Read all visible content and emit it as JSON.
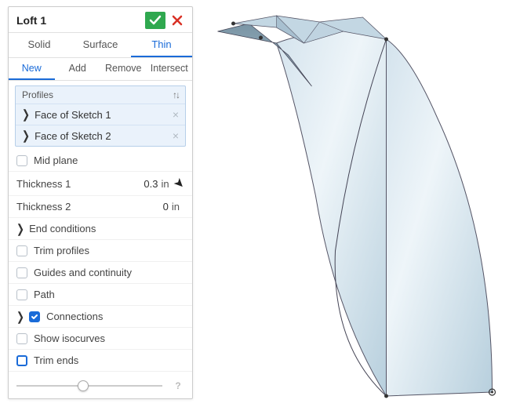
{
  "panel": {
    "title": "Loft 1",
    "tabs": {
      "solid": "Solid",
      "surface": "Surface",
      "thin": "Thin"
    },
    "active_tab": "thin",
    "subtabs": {
      "new": "New",
      "add": "Add",
      "remove": "Remove",
      "intersect": "Intersect"
    },
    "active_subtab": "new",
    "profiles": {
      "header": "Profiles",
      "items": [
        {
          "label": "Face of Sketch 1"
        },
        {
          "label": "Face of Sketch 2"
        }
      ]
    },
    "options": {
      "mid_plane": "Mid plane",
      "thickness1_label": "Thickness 1",
      "thickness1_value": "0.3",
      "thickness1_unit": "in",
      "thickness2_label": "Thickness 2",
      "thickness2_value": "0",
      "thickness2_unit": "in",
      "end_conditions": "End conditions",
      "trim_profiles": "Trim profiles",
      "guides": "Guides and continuity",
      "path": "Path",
      "connections": "Connections",
      "show_isocurves": "Show isocurves",
      "trim_ends": "Trim ends"
    }
  }
}
